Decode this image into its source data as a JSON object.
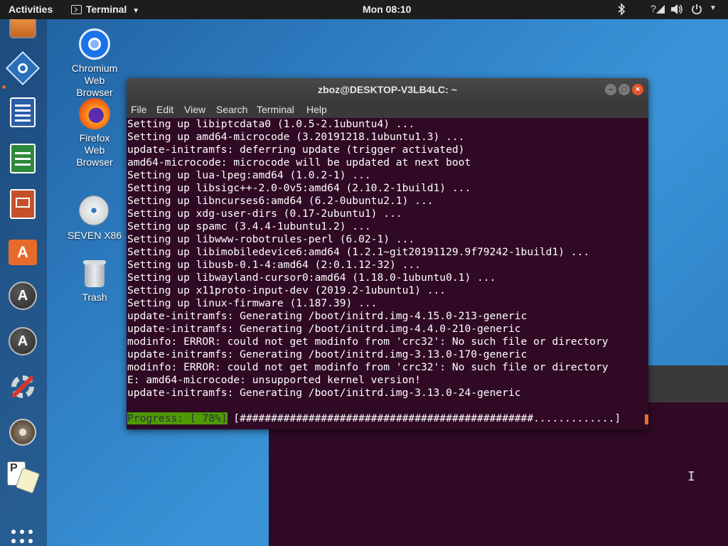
{
  "topbar": {
    "activities": "Activities",
    "app_menu": "Terminal",
    "clock": "Mon 08:10"
  },
  "dock": {
    "items": [
      "folder",
      "synaptic",
      "libreoffice-writer",
      "libreoffice-calc",
      "libreoffice-impress",
      "ubuntu-software",
      "software-updater",
      "software-updater-2",
      "settings-tools",
      "disks",
      "aisleriot"
    ]
  },
  "desktop": {
    "icons": [
      {
        "label_lines": [
          "Chromium",
          "Web",
          "Browser"
        ]
      },
      {
        "label_lines": [
          "Firefox",
          "Web",
          "Browser"
        ]
      },
      {
        "label": "SEVEN X86"
      },
      {
        "label": "Trash"
      }
    ]
  },
  "terminal": {
    "title": "zboz@DESKTOP-V3LB4LC: ~",
    "menu": [
      "File",
      "Edit",
      "View",
      "Search",
      "Terminal",
      "Help"
    ],
    "lines": [
      "Setting up libiptcdata0 (1.0.5-2.1ubuntu4) ...",
      "Setting up amd64-microcode (3.20191218.1ubuntu1.3) ...",
      "update-initramfs: deferring update (trigger activated)",
      "amd64-microcode: microcode will be updated at next boot",
      "Setting up lua-lpeg:amd64 (1.0.2-1) ...",
      "Setting up libsigc++-2.0-0v5:amd64 (2.10.2-1build1) ...",
      "Setting up libncurses6:amd64 (6.2-0ubuntu2.1) ...",
      "Setting up xdg-user-dirs (0.17-2ubuntu1) ...",
      "Setting up spamc (3.4.4-1ubuntu1.2) ...",
      "Setting up libwww-robotrules-perl (6.02-1) ...",
      "Setting up libimobiledevice6:amd64 (1.2.1~git20191129.9f79242-1build1) ...",
      "Setting up libusb-0.1-4:amd64 (2:0.1.12-32) ...",
      "Setting up libwayland-cursor0:amd64 (1.18.0-1ubuntu0.1) ...",
      "Setting up x11proto-input-dev (2019.2-1ubuntu1) ...",
      "Setting up linux-firmware (1.187.39) ...",
      "update-initramfs: Generating /boot/initrd.img-4.15.0-213-generic",
      "update-initramfs: Generating /boot/initrd.img-4.4.0-210-generic",
      "modinfo: ERROR: could not get modinfo from 'crc32': No such file or directory",
      "update-initramfs: Generating /boot/initrd.img-3.13.0-170-generic",
      "modinfo: ERROR: could not get modinfo from 'crc32': No such file or directory",
      "E: amd64-microcode: unsupported kernel version!",
      "update-initramfs: Generating /boot/initrd.img-3.13.0-24-generic"
    ],
    "progress_label": "Progress: [ 78%]",
    "progress_bar": "[###############################################.............]",
    "progress_percent": 78
  },
  "colors": {
    "terminal_bg": "#300a24",
    "progress_green": "#4e9a06",
    "accent_orange": "#e66b2c"
  }
}
